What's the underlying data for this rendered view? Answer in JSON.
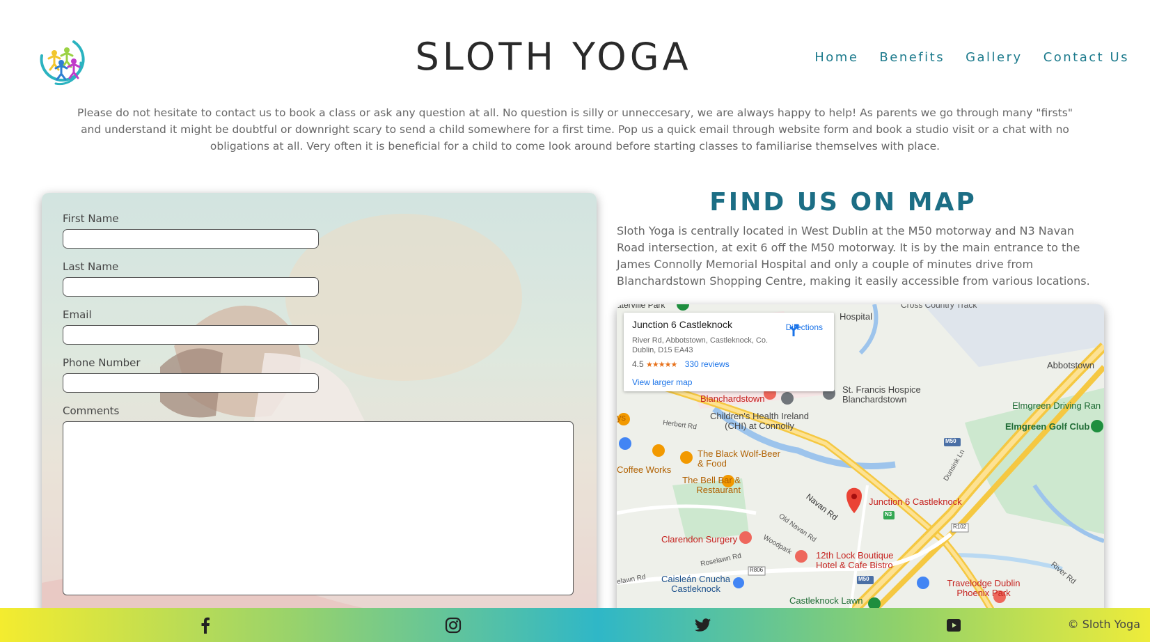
{
  "header": {
    "title": "SLOTH YOGA",
    "logo_icon": "colorful-dancing-figures-logo",
    "nav": [
      "Home",
      "Benefits",
      "Gallery",
      "Contact Us"
    ]
  },
  "intro": "Please do not hesitate to contact us to book a class or ask any question at all. No question is silly or unneccesary, we are always happy to help! As parents we go through many \"firsts\" and understand it might be doubtful or downright scary to send a child somewhere for a first time. Pop us a quick email through website form and book a studio visit or a chat with no obligations at all. Very often it is beneficial for a child to come look around before starting classes to familiarise themselves with place.",
  "form": {
    "first_name_label": "First Name",
    "last_name_label": "Last Name",
    "email_label": "Email",
    "phone_label": "Phone Number",
    "comments_label": "Comments"
  },
  "map_section": {
    "heading": "FIND US ON MAP",
    "description": "Sloth Yoga is centrally located in West Dublin at the M50 motorway and N3 Navan Road intersection, at exit 6 off the M50 motorway. It is by the main entrance to the James Connolly Memorial Hospital and only a couple of minutes drive from Blanchardstown Shopping Centre, making it easily accessible from various locations.",
    "card": {
      "title": "Junction 6 Castleknock",
      "address": "River Rd, Abbotstown, Castleknock, Co. Dublin, D15 EA43",
      "rating": "4.5",
      "stars": "★★★★★",
      "reviews": "330 reviews",
      "larger_map": "View larger map",
      "directions": "Directions"
    },
    "places": {
      "hospital": "Hospital",
      "cross_country": "Cross Country Track",
      "abbotstown": "Abbotstown",
      "st_francis": "St. Francis Hospice Blanchardstown",
      "blanchardstown": "Blanchardstown",
      "childrens": "Children's Health Ireland (CHI) at Connolly",
      "elmgreen_range": "Elmgreen Driving Ran",
      "elmgreen_golf": "Elmgreen Golf Club",
      "herbert_rd": "Herbert Rd",
      "black_wolf": "The Black Wolf-Beer & Food",
      "coffee": "Coffee Works",
      "bell_bar": "The Bell Bar & Restaurant",
      "navan_rd": "Navan Rd",
      "old_navan_rd": "Old Navan Rd",
      "junction": "Junction 6 Castleknock",
      "clarendon": "Clarendon Surgery",
      "woodpark": "Woodpark",
      "roselawn": "Roselawn Rd",
      "lock_boutique": "12th Lock Boutique Hotel & Cafe Bistro",
      "caislean": "Caisleán Cnucha Castleknock",
      "castleknock_lawn": "Castleknock Lawn",
      "travelodge": "Travelodge Dublin Phoenix Park",
      "river_rd": "River Rd",
      "dunsink": "Dunsink Ln",
      "elm_rd": "elawn Rd",
      "ys": "ys",
      "park": "aterville Park",
      "m50a": "M50",
      "m50b": "M50",
      "n3": "N3",
      "r102": "R102",
      "r806": "R806"
    }
  },
  "footer": {
    "icons": [
      "facebook-icon",
      "instagram-icon",
      "twitter-icon",
      "youtube-icon"
    ],
    "copyright": "© Sloth Yoga"
  }
}
